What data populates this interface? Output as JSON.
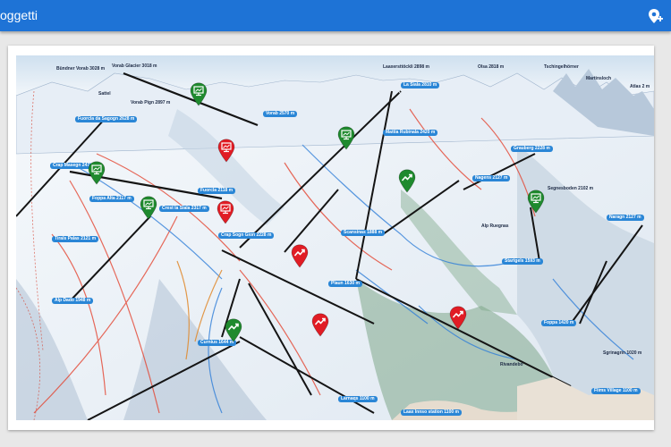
{
  "header": {
    "title": "oggetti",
    "add_location_icon": "add-location-icon",
    "color": "#1e73d6"
  },
  "map": {
    "peaks": [
      "Bündner Vorab 3028 m",
      "Vorab Glacier 3018 m",
      "Laaxersttöckli 2898 m",
      "Olsa 2818 m",
      "Tschingelhörner",
      "Martinsloch",
      "Atlas 2 m",
      "Vorab Pign 2897 m",
      "Sattel",
      "Alp Ruegnas"
    ],
    "stations": [
      "Fuorcla da Sagogn 2628 m",
      "Vorab 2570 m",
      "La Siala 2810 m",
      "Mattia Rubinala 2420 m",
      "Grauberg 2228 m",
      "Crap Masegn 2477 m",
      "Foppa Alta 2117 m",
      "Segnesboden 2102 m",
      "Fuorcla 2118 m",
      "Crest la Siala 2317 m",
      "Naragn 2127 m",
      "Nagens 2127 m",
      "Tirals Palas 2121 m",
      "Crap Sogn Gion 2228 m",
      "Scansinas 1888 m",
      "Startgels 1593 m",
      "Alp Dado 1948 m",
      "Plaun 1630 m",
      "Foppa 1420 m",
      "Curnius 1644 m",
      "Larnaqs 1100 m",
      "Flims Village 1100 m",
      "Laax Innso station 1100 m",
      "Rivandebo",
      "Sgrinagrin 1020 m"
    ],
    "markers": [
      {
        "type": "presentation",
        "color": "green"
      },
      {
        "type": "presentation",
        "color": "red"
      },
      {
        "type": "presentation",
        "color": "green"
      },
      {
        "type": "presentation",
        "color": "green"
      },
      {
        "type": "trend",
        "color": "green"
      },
      {
        "type": "presentation",
        "color": "green"
      },
      {
        "type": "presentation",
        "color": "green"
      },
      {
        "type": "presentation",
        "color": "red"
      },
      {
        "type": "trend",
        "color": "red"
      },
      {
        "type": "trend",
        "color": "red"
      },
      {
        "type": "trend",
        "color": "red"
      },
      {
        "type": "trend",
        "color": "green"
      }
    ],
    "colors": {
      "green": "#1f8a2e",
      "red": "#e11c24",
      "label": "#2a86d6"
    }
  }
}
